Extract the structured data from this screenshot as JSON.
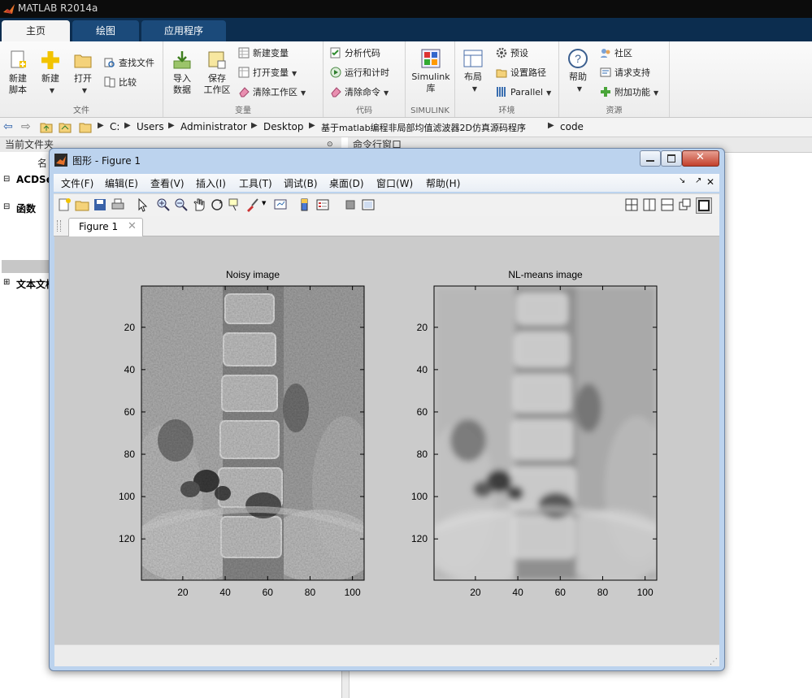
{
  "app": {
    "title": "MATLAB R2014a"
  },
  "ribbon_tabs": [
    "主页",
    "绘图",
    "应用程序"
  ],
  "ribbon": {
    "file_group": {
      "label": "文件",
      "new_script": [
        "新建",
        "脚本"
      ],
      "new": "新建",
      "open": "打开",
      "find_files": "查找文件",
      "compare": "比较"
    },
    "variable_group": {
      "label": "变量",
      "import_data": [
        "导入",
        "数据"
      ],
      "save_workspace": [
        "保存",
        "工作区"
      ],
      "new_variable": "新建变量",
      "open_variable": "打开变量",
      "clear_workspace": "清除工作区"
    },
    "code_group": {
      "label": "代码",
      "analyze_code": "分析代码",
      "run_and_time": "运行和计时",
      "clear_commands": "清除命令"
    },
    "simulink_group": {
      "label": "SIMULINK",
      "simulink_library": [
        "Simulink",
        "库"
      ]
    },
    "environment_group": {
      "label": "环境",
      "layout": "布局",
      "preferences": "预设",
      "set_path": "设置路径",
      "parallel": "Parallel"
    },
    "resources_group": {
      "label": "资源",
      "help": "帮助",
      "community": "社区",
      "request_support": "请求支持",
      "add_ons": "附加功能"
    }
  },
  "address_path": [
    "C:",
    "Users",
    "Administrator",
    "Desktop",
    "基于matlab编程非局部均值滤波器2D仿真源码程序",
    "code"
  ],
  "current_folder": {
    "title": "当前文件夹",
    "name_column": "名",
    "tree": [
      "ACDSe",
      "函数",
      "文本文档"
    ]
  },
  "command_window": {
    "title": "命令行窗口"
  },
  "figure": {
    "window_title": "图形 - Figure 1",
    "menus": [
      "文件(F)",
      "编辑(E)",
      "查看(V)",
      "插入(I)",
      "工具(T)",
      "调试(B)",
      "桌面(D)",
      "窗口(W)",
      "帮助(H)"
    ],
    "tab_label": "Figure 1"
  },
  "plots": [
    {
      "title": "Noisy image",
      "x_ticks": [
        "20",
        "40",
        "60",
        "80",
        "100"
      ],
      "y_ticks": [
        "20",
        "40",
        "60",
        "80",
        "100",
        "120"
      ]
    },
    {
      "title": "NL-means image",
      "x_ticks": [
        "20",
        "40",
        "60",
        "80",
        "100"
      ],
      "y_ticks": [
        "20",
        "40",
        "60",
        "80",
        "100",
        "120"
      ]
    }
  ],
  "colors": {
    "title_bar": "#0c0c0c",
    "ribbon_tab_bar": "#0c2d4f",
    "figure_frame": "#bcd3ee",
    "figure_canvas": "#cbcbcb",
    "close_button": "#c2402b"
  }
}
